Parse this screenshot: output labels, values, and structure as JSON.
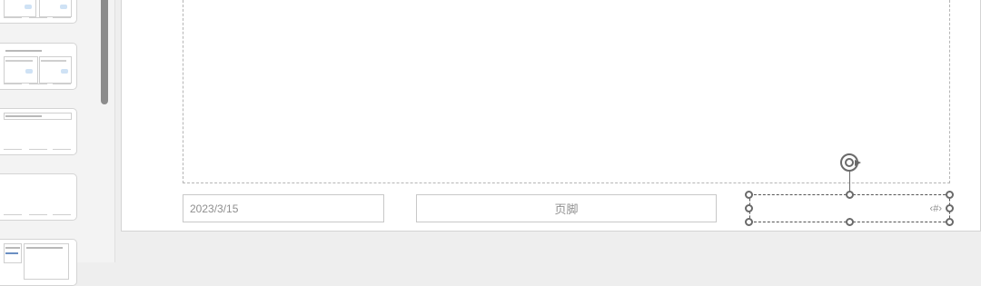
{
  "slide": {
    "date": "2023/3/15",
    "footer": "页脚",
    "slide_number": "‹#›"
  },
  "icons": {
    "rotate_handle": "rotate-handle-icon",
    "resize_handle": "resize-handle-icon"
  },
  "colors": {
    "selection": "#6a6a6a",
    "placeholder_border": "#b5b5b5"
  }
}
